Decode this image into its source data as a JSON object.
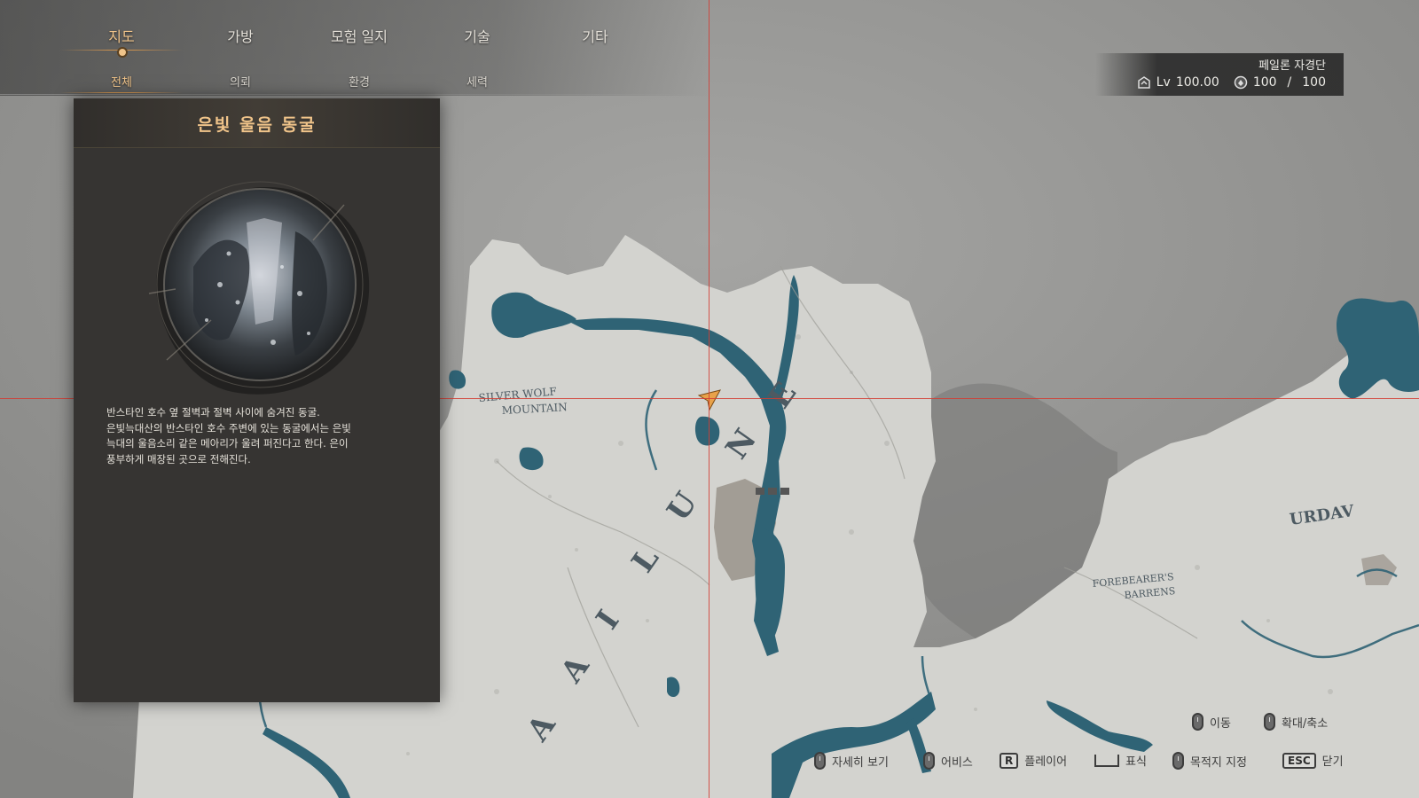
{
  "nav": {
    "tabs": [
      {
        "label": "지도",
        "active": true
      },
      {
        "label": "가방"
      },
      {
        "label": "모험 일지"
      },
      {
        "label": "기술"
      },
      {
        "label": "기타"
      }
    ],
    "subtabs": [
      {
        "label": "전체",
        "active": true
      },
      {
        "label": "의뢰"
      },
      {
        "label": "환경"
      },
      {
        "label": "세력"
      }
    ]
  },
  "player": {
    "name": "페일론 자경단",
    "level_label": "Lv",
    "level": "100.00",
    "stat_current": "100",
    "stat_separator": "/",
    "stat_max": "100"
  },
  "detail": {
    "title": "은빛 울음 동굴",
    "description": "반스타인 호수 옆 절벽과 절벽 사이에 숨겨진 동굴.\n은빛늑대산의 반스타인 호수 주변에 있는 동굴에서는 은빛\n늑대의 울음소리 같은 메아리가 울려 퍼진다고 한다. 은이\n풍부하게 매장된 곳으로 전해진다."
  },
  "map": {
    "labels": {
      "silver_wolf_1": "SILVER WOLF",
      "silver_wolf_2": "MOUNTAIN",
      "pailune": "PAILUNE",
      "urdavah": "URDAV",
      "forebearers_1": "FOREBEARER'S",
      "forebearers_2": "BARRENS"
    },
    "colors": {
      "fog": "#8f8f8d",
      "land": "#d2d2ce",
      "water": "#2f6375",
      "label": "#4d5a62",
      "marker": "#e8a24a"
    }
  },
  "hints": {
    "move": "이동",
    "zoom": "확대/축소",
    "detail_view": "자세히 보기",
    "bookmark": "어비스",
    "player": "플레이어",
    "mark": "표식",
    "waypoint": "목적지 지정",
    "close": "닫기",
    "key_r": "R",
    "key_esc": "ESC"
  },
  "theme": {
    "accent": "#f0c48a",
    "panel_bg": "#363432",
    "crosshair": "#d23c32"
  }
}
